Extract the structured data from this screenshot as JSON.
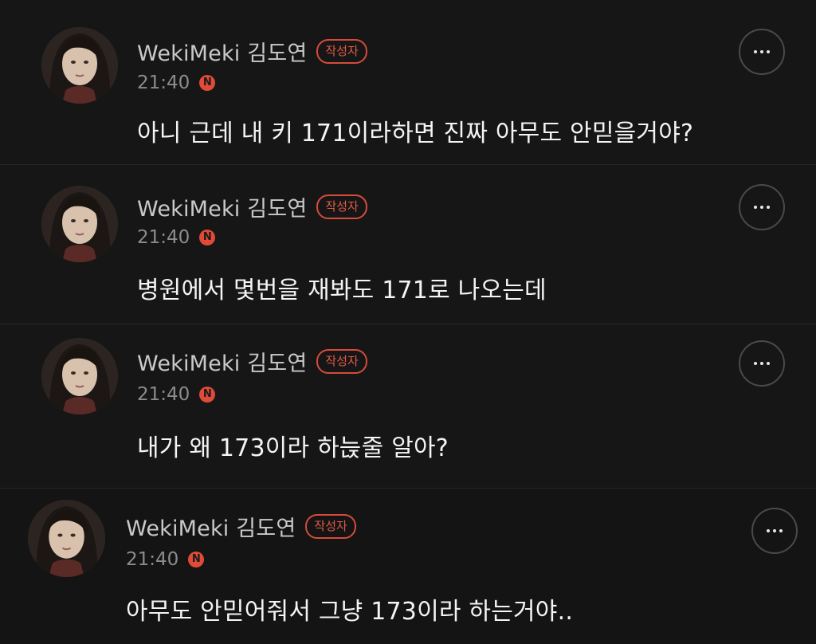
{
  "posts": [
    {
      "author": "WekiMeki 김도연",
      "badge": "작성자",
      "time": "21:40",
      "new_badge": "N",
      "text": "아니 근데 내 키 171이라하면 진짜 아무도 안믿을거야?"
    },
    {
      "author": "WekiMeki 김도연",
      "badge": "작성자",
      "time": "21:40",
      "new_badge": "N",
      "text": "병원에서 몇번을 재봐도 171로 나오는데"
    },
    {
      "author": "WekiMeki 김도연",
      "badge": "작성자",
      "time": "21:40",
      "new_badge": "N",
      "text": "내가 왜 173이라 하늕줄 알아?"
    },
    {
      "author": "WekiMeki 김도연",
      "badge": "작성자",
      "time": "21:40",
      "new_badge": "N",
      "text": "아무도 안믿어줘서 그냥 173이라 하는거야.."
    }
  ],
  "colors": {
    "background": "#161616",
    "accent": "#e04a38",
    "author_text": "#c9c9c9",
    "time_text": "#8c8c8c"
  },
  "icons": {
    "more": "more-horizontal-icon",
    "new": "new-badge-icon"
  }
}
